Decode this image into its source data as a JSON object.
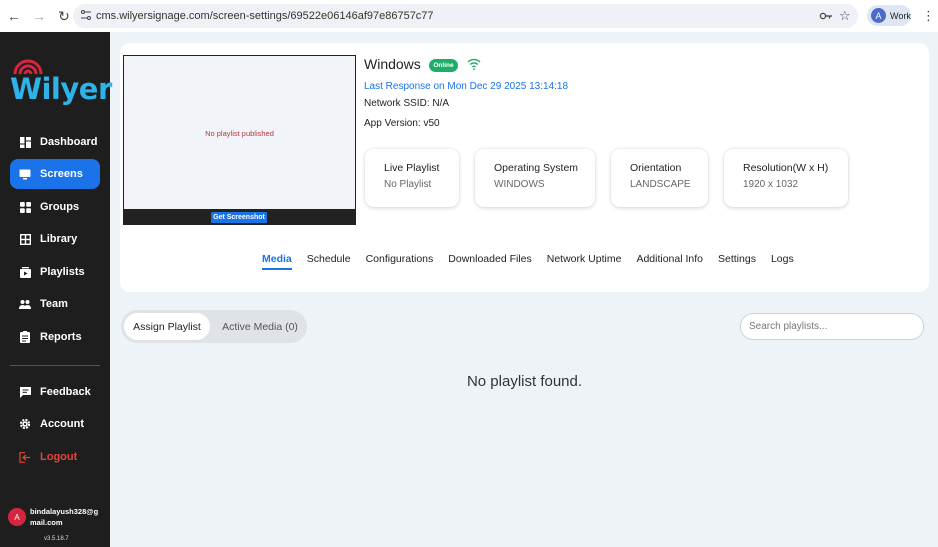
{
  "browser": {
    "url": "cms.wilyersignage.com/screen-settings/69522e06146af97e86757c77",
    "profile_initial": "A",
    "profile_label": "Work"
  },
  "sidebar": {
    "logo_text": "Wilyer",
    "items": [
      {
        "label": "Dashboard",
        "icon": "dashboard-icon"
      },
      {
        "label": "Screens",
        "icon": "screen-icon",
        "active": true
      },
      {
        "label": "Groups",
        "icon": "groups-icon"
      },
      {
        "label": "Library",
        "icon": "library-icon"
      },
      {
        "label": "Playlists",
        "icon": "playlists-icon"
      },
      {
        "label": "Team",
        "icon": "team-icon"
      },
      {
        "label": "Reports",
        "icon": "reports-icon"
      }
    ],
    "bottom_items": [
      {
        "label": "Feedback",
        "icon": "feedback-icon"
      },
      {
        "label": "Account",
        "icon": "gear-icon"
      },
      {
        "label": "Logout",
        "icon": "logout-icon"
      }
    ],
    "user": {
      "initial": "A",
      "email": "bindalayush328@gmail.com"
    },
    "version": "v3.5.18.7"
  },
  "screen": {
    "preview_message": "No playlist published",
    "screenshot_button": "Get Screenshot",
    "name": "Windows",
    "status": "Online",
    "last_response": "Last Response on  Mon Dec 29 2025 13:14:18",
    "ssid": "Network SSID: N/A",
    "app_version": "App Version: v50"
  },
  "stats": [
    {
      "label": "Live Playlist",
      "value": "No Playlist"
    },
    {
      "label": "Operating System",
      "value": "WINDOWS"
    },
    {
      "label": "Orientation",
      "value": "LANDSCAPE"
    },
    {
      "label": "Resolution(W x H)",
      "value": "1920 x 1032"
    }
  ],
  "tabs": [
    "Media",
    "Schedule",
    "Configurations",
    "Downloaded Files",
    "Network Uptime",
    "Additional Info",
    "Settings",
    "Logs"
  ],
  "media": {
    "assign_label": "Assign Playlist",
    "active_label": "Active Media (0)",
    "search_placeholder": "Search playlists...",
    "empty_message": "No playlist found."
  },
  "colors": {
    "accent": "#1a73e8",
    "online": "#1fae67",
    "logout": "#e0453a",
    "logo": "#2fb2e8"
  }
}
